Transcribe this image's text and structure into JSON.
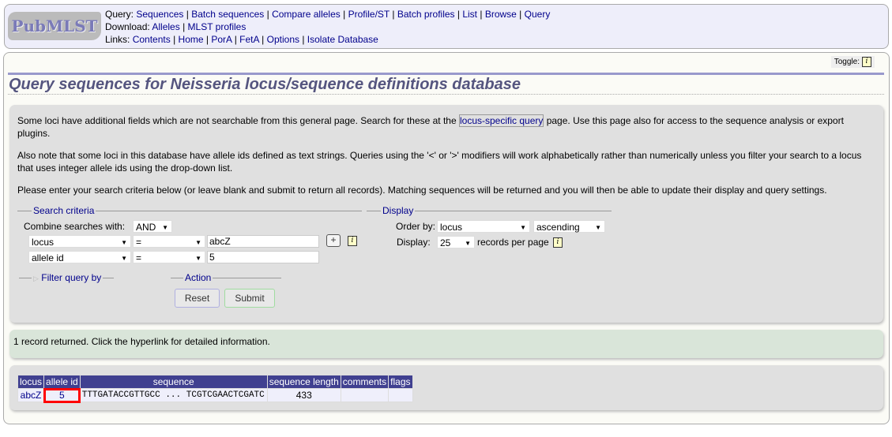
{
  "logo": "PubMLST",
  "nav": {
    "query_label": "Query:",
    "query": [
      "Sequences",
      "Batch sequences",
      "Compare alleles",
      "Profile/ST",
      "Batch profiles",
      "List",
      "Browse",
      "Query"
    ],
    "download_label": "Download:",
    "download": [
      "Alleles",
      "MLST profiles"
    ],
    "links_label": "Links:",
    "links": [
      "Contents",
      "Home",
      "PorA",
      "FetA",
      "Options",
      "Isolate Database"
    ]
  },
  "toggle": "Toggle:",
  "title": "Query sequences for Neisseria locus/sequence definitions database",
  "intro": {
    "p1_a": "Some loci have additional fields which are not searchable from this general page. Search for these at the ",
    "p1_link": "locus-specific query",
    "p1_b": " page. Use this page also for access to the sequence analysis or export plugins.",
    "p2": "Also note that some loci in this database have allele ids defined as text strings. Queries using the '<' or '>' modifiers will work alphabetically rather than numerically unless you filter your search to a locus that uses integer allele ids using the drop-down list.",
    "p3": "Please enter your search criteria below (or leave blank and submit to return all records). Matching sequences will be returned and you will then be able to update their display and query settings."
  },
  "search": {
    "legend": "Search criteria",
    "combine_label": "Combine searches with:",
    "combine": "AND",
    "rows": [
      {
        "field": "locus",
        "op": "=",
        "value": "abcZ"
      },
      {
        "field": "allele id",
        "op": "=",
        "value": "5"
      }
    ],
    "add": "+"
  },
  "display": {
    "legend": "Display",
    "order_label": "Order by:",
    "order": "locus",
    "direction": "ascending",
    "display_label": "Display:",
    "per_page": "25",
    "per_page_suffix": "records per page"
  },
  "filter": {
    "legend": "Filter query by"
  },
  "action": {
    "legend": "Action",
    "reset": "Reset",
    "submit": "Submit"
  },
  "result_msg": "1 record returned. Click the hyperlink for detailed information.",
  "results": {
    "headers": [
      "locus",
      "allele id",
      "sequence",
      "sequence length",
      "comments",
      "flags"
    ],
    "rows": [
      {
        "locus": "abcZ",
        "allele_id": "5",
        "sequence": "TTTGATACCGTTGCC ... TCGTCGAACTCGATC",
        "length": "433",
        "comments": "",
        "flags": ""
      }
    ],
    "highlight_color": "#ff0000"
  }
}
